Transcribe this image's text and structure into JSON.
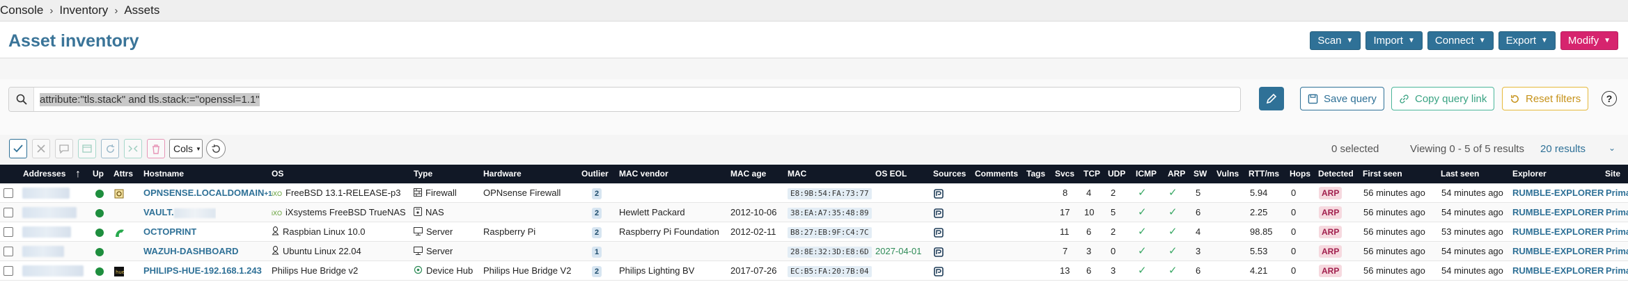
{
  "breadcrumb": [
    "Console",
    "Inventory",
    "Assets"
  ],
  "page": {
    "title": "Asset inventory"
  },
  "header_buttons": [
    {
      "label": "Scan",
      "color": "#2f7197"
    },
    {
      "label": "Import",
      "color": "#2f7197"
    },
    {
      "label": "Connect",
      "color": "#2f7197"
    },
    {
      "label": "Export",
      "color": "#2f7197"
    },
    {
      "label": "Modify",
      "color": "#d6246e"
    }
  ],
  "query": {
    "value": "attribute:\"tls.stack\" and tls.stack:=\"openssl=1.1\"",
    "save_label": "Save query",
    "copy_label": "Copy query link",
    "reset_label": "Reset filters",
    "help_label": "?"
  },
  "toolbar": {
    "cols_label": "Cols",
    "selected_text": "0 selected",
    "viewing_text": "Viewing 0 - 5 of 5 results",
    "results_label": "20 results"
  },
  "columns": [
    "Addresses",
    "Up",
    "Attrs",
    "Hostname",
    "OS",
    "Type",
    "Hardware",
    "Outlier",
    "MAC vendor",
    "MAC age",
    "MAC",
    "OS EOL",
    "Sources",
    "Comments",
    "Tags",
    "Svcs",
    "TCP",
    "UDP",
    "ICMP",
    "ARP",
    "SW",
    "Vulns",
    "RTT/ms",
    "Hops",
    "Detected",
    "First seen",
    "Last seen",
    "Explorer",
    "Site"
  ],
  "rows": [
    {
      "addr_extra": "+1",
      "hostname": "OPNSENSE.LOCALDOMAIN",
      "os": "FreeBSD 13.1-RELEASE-p3",
      "os_icon": "freebsd-icon",
      "type": "Firewall",
      "type_icon": "firewall-icon",
      "hardware": "OPNsense Firewall",
      "outlier": "2",
      "mac_vendor": "",
      "mac_age": "",
      "mac": "E8:9B:54:FA:73:77",
      "os_eol": "",
      "svcs": "8",
      "tcp": "4",
      "udp": "2",
      "sw": "5",
      "vulns": "",
      "rtt": "5.94",
      "hops": "0",
      "detected": "ARP",
      "first_seen": "56 minutes ago",
      "last_seen": "54 minutes ago",
      "explorer": "RUMBLE-EXPLORER",
      "site": "Prima"
    },
    {
      "addr_extra": "",
      "hostname": "VAULT.",
      "os": "iXsystems FreeBSD TrueNAS",
      "os_icon": "freebsd-icon",
      "type": "NAS",
      "type_icon": "nas-icon",
      "hardware": "",
      "outlier": "2",
      "mac_vendor": "Hewlett Packard",
      "mac_age": "2012-10-06",
      "mac": "38:EA:A7:35:48:89",
      "os_eol": "",
      "svcs": "17",
      "tcp": "10",
      "udp": "5",
      "sw": "6",
      "vulns": "",
      "rtt": "2.25",
      "hops": "0",
      "detected": "ARP",
      "first_seen": "56 minutes ago",
      "last_seen": "54 minutes ago",
      "explorer": "RUMBLE-EXPLORER",
      "site": "Prima"
    },
    {
      "addr_extra": "",
      "hostname": "OCTOPRINT",
      "os": "Raspbian Linux 10.0",
      "os_icon": "linux-icon",
      "type": "Server",
      "type_icon": "server-icon",
      "hardware": "Raspberry Pi",
      "outlier": "2",
      "mac_vendor": "Raspberry Pi Foundation",
      "mac_age": "2012-02-11",
      "mac": "B8:27:EB:9F:C4:7C",
      "os_eol": "",
      "svcs": "11",
      "tcp": "6",
      "udp": "2",
      "sw": "4",
      "vulns": "",
      "rtt": "98.85",
      "hops": "0",
      "detected": "ARP",
      "first_seen": "56 minutes ago",
      "last_seen": "53 minutes ago",
      "explorer": "RUMBLE-EXPLORER",
      "site": "Prima"
    },
    {
      "addr_extra": "",
      "hostname": "WAZUH-DASHBOARD",
      "os": "Ubuntu Linux 22.04",
      "os_icon": "linux-icon",
      "type": "Server",
      "type_icon": "server-icon",
      "hardware": "",
      "outlier": "1",
      "mac_vendor": "",
      "mac_age": "",
      "mac": "28:8E:32:3D:E8:6D",
      "os_eol": "2027-04-01",
      "svcs": "7",
      "tcp": "3",
      "udp": "0",
      "sw": "3",
      "vulns": "",
      "rtt": "5.53",
      "hops": "0",
      "detected": "ARP",
      "first_seen": "56 minutes ago",
      "last_seen": "54 minutes ago",
      "explorer": "RUMBLE-EXPLORER",
      "site": "Prima"
    },
    {
      "addr_extra": "",
      "hostname": "PHILIPS-HUE-192.168.1.243",
      "os": "Philips Hue Bridge v2",
      "os_icon": "",
      "type": "Device Hub",
      "type_icon": "hub-icon",
      "hardware": "Philips Hue Bridge V2",
      "outlier": "2",
      "mac_vendor": "Philips Lighting BV",
      "mac_age": "2017-07-26",
      "mac": "EC:B5:FA:20:7B:04",
      "os_eol": "",
      "svcs": "13",
      "tcp": "6",
      "udp": "3",
      "sw": "6",
      "vulns": "",
      "rtt": "4.21",
      "hops": "0",
      "detected": "ARP",
      "first_seen": "56 minutes ago",
      "last_seen": "54 minutes ago",
      "explorer": "RUMBLE-EXPLORER",
      "site": "Prima"
    }
  ]
}
